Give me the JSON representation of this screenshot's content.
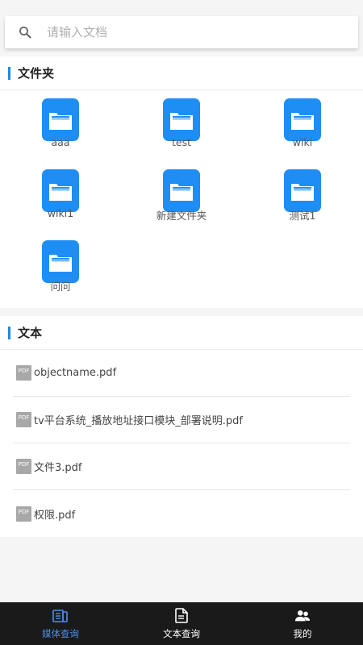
{
  "search": {
    "placeholder": "请输入文档",
    "value": ""
  },
  "folders_section": {
    "title": "文件夹",
    "items": [
      {
        "label": "aaa"
      },
      {
        "label": "test"
      },
      {
        "label": "wiki"
      },
      {
        "label": "wiki1"
      },
      {
        "label": "新建文件夹"
      },
      {
        "label": "测试1"
      },
      {
        "label": "问问"
      }
    ]
  },
  "text_section": {
    "title": "文本",
    "files": [
      {
        "icon": "pdf-icon",
        "badge": "PDF",
        "name": "objectname.pdf"
      },
      {
        "icon": "pdf-icon",
        "badge": "PDF",
        "name": "tv平台系统_播放地址接口模块_部署说明.pdf"
      },
      {
        "icon": "pdf-icon",
        "badge": "PDF",
        "name": "文件3.pdf"
      },
      {
        "icon": "pdf-icon",
        "badge": "PDF",
        "name": "权限.pdf"
      }
    ]
  },
  "bottom_nav": {
    "items": [
      {
        "label": "媒体查询",
        "icon": "media-icon",
        "active": true
      },
      {
        "label": "文本查询",
        "icon": "document-icon",
        "active": false
      },
      {
        "label": "我的",
        "icon": "users-icon",
        "active": false
      }
    ]
  },
  "colors": {
    "accent": "#1e8ef5",
    "active_nav": "#4a8fef",
    "nav_bg": "#1a1a1a"
  }
}
